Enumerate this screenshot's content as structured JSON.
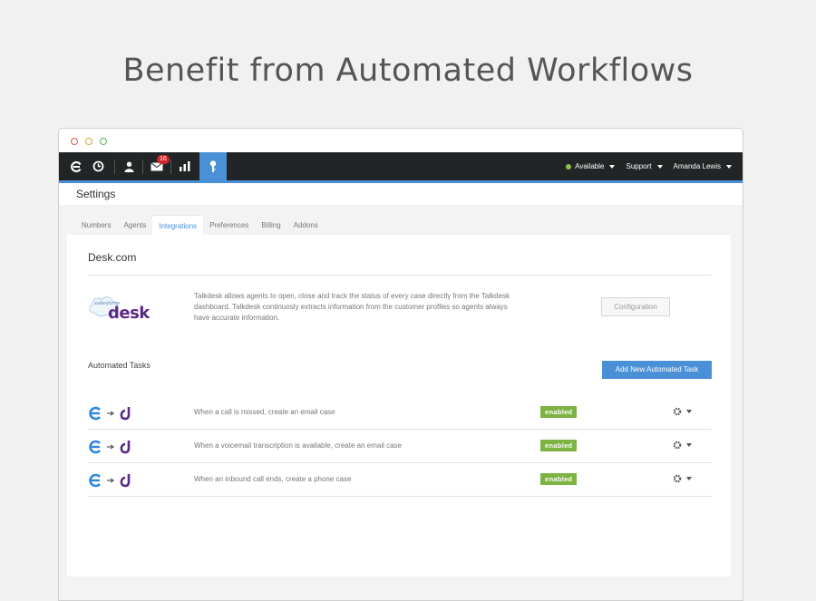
{
  "hero": {
    "title": "Benefit from Automated Workflows"
  },
  "navbar": {
    "badge_count": "16",
    "status_label": "Available",
    "support_label": "Support",
    "user_label": "Amanda Lewis",
    "colors": {
      "bar": "#212526",
      "accent": "#4a90d6",
      "status": "#8bc34a",
      "badge": "#d0262b"
    }
  },
  "settings": {
    "title": "Settings",
    "tabs": [
      {
        "label": "Numbers",
        "active": false
      },
      {
        "label": "Agents",
        "active": false
      },
      {
        "label": "Integrations",
        "active": true
      },
      {
        "label": "Preferences",
        "active": false
      },
      {
        "label": "Billing",
        "active": false
      },
      {
        "label": "Addons",
        "active": false
      }
    ]
  },
  "integration": {
    "title": "Desk.com",
    "logo_text": "desk",
    "logo_small_text": "salesforce",
    "description": "Talkdesk allows agents to open, close and track the status of every case directly from the Talkdesk dashboard. Talkdesk continuosly extracts information from the customer profiles so agents always have accurate information.",
    "config_label": "Configuration"
  },
  "tasks": {
    "section_label": "Automated Tasks",
    "add_label": "Add New Automated Task",
    "items": [
      {
        "text": "When a call is missed, create an email case",
        "status": "enabled"
      },
      {
        "text": "When a voicemail transcription is available, create an email case",
        "status": "enabled"
      },
      {
        "text": "When an inbound call ends, create a phone case",
        "status": "enabled"
      }
    ],
    "colors": {
      "enabled": "#7cb342",
      "talkdesk": "#2e86de",
      "desk": "#5b2a86"
    }
  }
}
